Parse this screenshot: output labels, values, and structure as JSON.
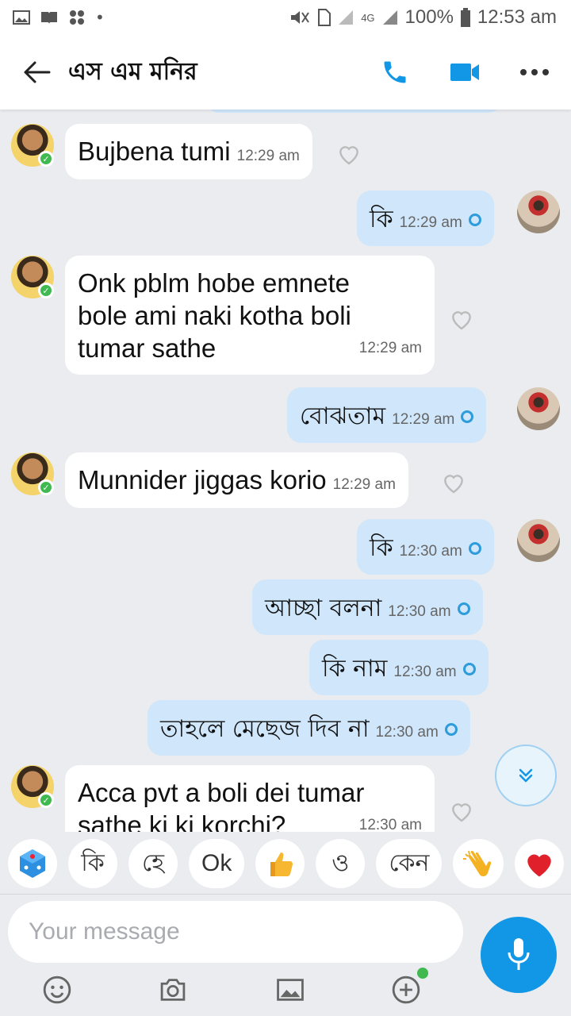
{
  "status_bar": {
    "battery": "100%",
    "time": "12:53 am",
    "network": "4G"
  },
  "header": {
    "title": "এস এম মনির"
  },
  "messages": [
    {
      "dir": "in",
      "text": "Bujbena tumi",
      "time": "12:29 am"
    },
    {
      "dir": "out",
      "text": "কি",
      "time": "12:29 am"
    },
    {
      "dir": "in",
      "lines": [
        "Onk pblm hobe emnete",
        "bole ami naki kotha boli",
        "tumar sathe"
      ],
      "time": "12:29 am"
    },
    {
      "dir": "out",
      "text": "বোঝতাম",
      "time": "12:29 am"
    },
    {
      "dir": "in",
      "text": "Munnider jiggas korio",
      "time": "12:29 am"
    },
    {
      "dir": "out",
      "text": "কি",
      "time": "12:30 am"
    },
    {
      "dir": "out",
      "text": "আচ্ছা বলনা",
      "time": "12:30 am"
    },
    {
      "dir": "out",
      "text": "কি নাম",
      "time": "12:30 am"
    },
    {
      "dir": "out",
      "text": "তাহলে মেছেজ দিব না",
      "time": "12:30 am"
    },
    {
      "dir": "in",
      "lines": [
        "Acca pvt a boli dei tumar",
        "sathe ki ki korchi?"
      ],
      "time": "12:30 am"
    }
  ],
  "quick_replies": [
    "কি",
    "হে",
    "Ok",
    "ও",
    "কেন"
  ],
  "quick_reply_icons": [
    "dice-icon",
    "thumbs-up-icon",
    "clapping-hands-icon",
    "heart-icon"
  ],
  "composer": {
    "placeholder": "Your message"
  },
  "colors": {
    "accent": "#1197e6",
    "outgoing_bubble": "#cfe6fb",
    "online": "#3fb950"
  }
}
